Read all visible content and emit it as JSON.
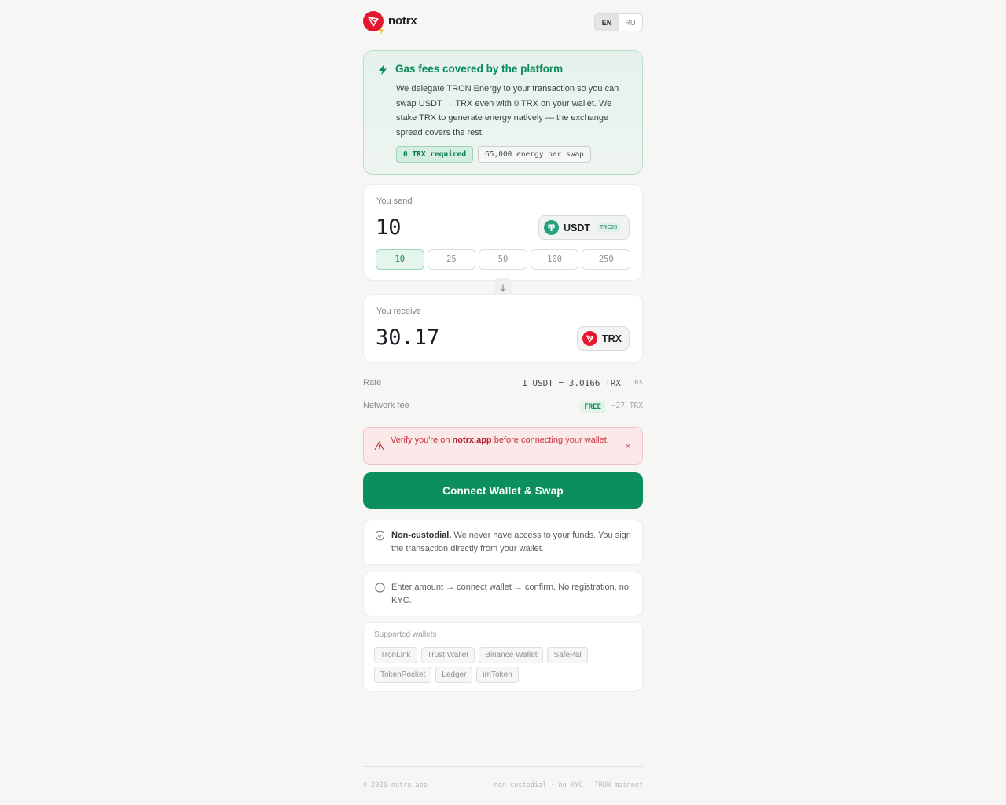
{
  "header": {
    "brand": "notrx",
    "lang": {
      "en": "EN",
      "ru": "RU",
      "active": "EN"
    }
  },
  "gas_banner": {
    "title": "Gas fees covered by the platform",
    "body": "We delegate TRON Energy to your transaction so you can swap USDT → TRX even with 0 TRX on your wallet. We stake TRX to generate energy natively — the exchange spread covers the rest.",
    "tags": [
      "0 TRX required",
      "65,000 energy per swap"
    ]
  },
  "send": {
    "label": "You send",
    "amount": "10",
    "token": "USDT",
    "network": "TRC20",
    "presets": [
      "10",
      "25",
      "50",
      "100",
      "250"
    ],
    "active_preset": "10"
  },
  "receive": {
    "label": "You receive",
    "amount": "30.17",
    "token": "TRX"
  },
  "rate": {
    "label": "Rate",
    "value": "1 USDT = 3.0166 TRX",
    "timer": "6s"
  },
  "fee": {
    "label": "Network fee",
    "badge": "FREE",
    "old_value": "~27 TRX"
  },
  "warning": {
    "prefix": "Verify you're on ",
    "domain": "notrx.app",
    "suffix": " before connecting your wallet.",
    "close": "×"
  },
  "cta": {
    "label": "Connect Wallet & Swap"
  },
  "info": {
    "custody_title": "Non-custodial.",
    "custody_text": " We never have access to your funds. You sign the transaction directly from your wallet.",
    "steps_text": "Enter amount → connect wallet → confirm. No registration, no KYC."
  },
  "wallets": {
    "label": "Supported wallets",
    "items": [
      "TronLink",
      "Trust Wallet",
      "Binance Wallet",
      "SafePal",
      "TokenPocket",
      "Ledger",
      "imToken"
    ]
  },
  "footer": {
    "left": "© 2026 notrx.app",
    "right": "non-custodial · no KYC · TRON mainnet"
  },
  "colors": {
    "accent": "#0b8f5d",
    "tron_red": "#e5172f",
    "tether_green": "#26a17b",
    "warning_red": "#c8303b"
  }
}
